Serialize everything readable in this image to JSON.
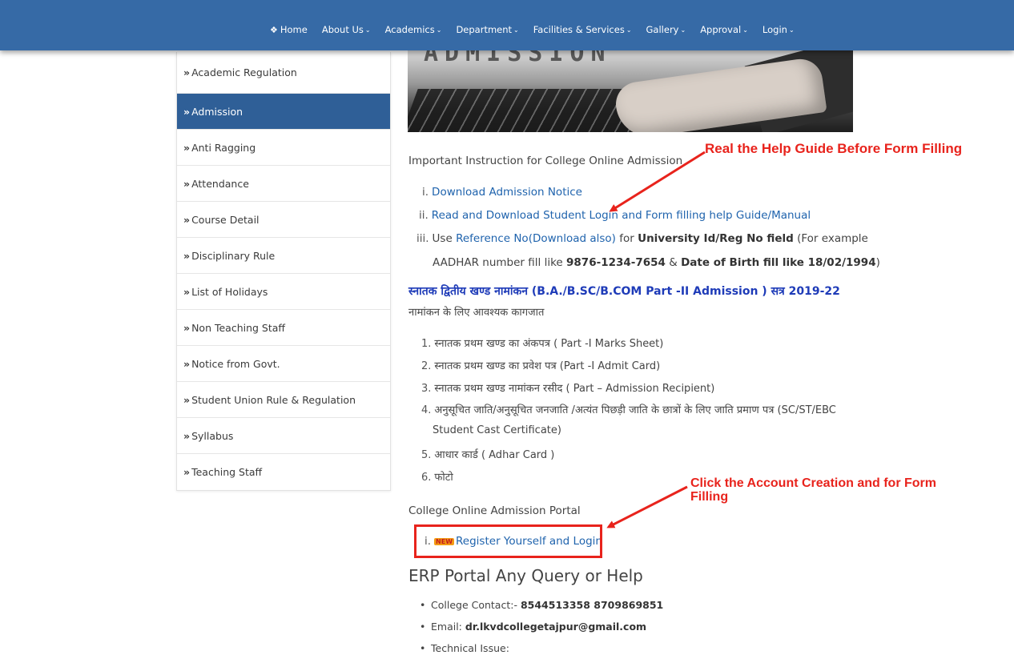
{
  "nav": {
    "items": [
      {
        "label": "Home",
        "icon": "home-icon",
        "chevron": false
      },
      {
        "label": "About Us",
        "chevron": true
      },
      {
        "label": "Academics",
        "chevron": true
      },
      {
        "label": "Department",
        "chevron": true
      },
      {
        "label": "Facilities & Services",
        "chevron": true
      },
      {
        "label": "Gallery",
        "chevron": true
      },
      {
        "label": "Approval",
        "chevron": true
      },
      {
        "label": "Login",
        "chevron": true
      }
    ]
  },
  "sidebar": {
    "items": [
      {
        "label": "Academic Regulation",
        "active": false
      },
      {
        "label": "Admission",
        "active": true
      },
      {
        "label": "Anti Ragging",
        "active": false
      },
      {
        "label": "Attendance",
        "active": false
      },
      {
        "label": "Course Detail",
        "active": false
      },
      {
        "label": "Disciplinary Rule",
        "active": false
      },
      {
        "label": "List of Holidays",
        "active": false
      },
      {
        "label": "Non Teaching Staff",
        "active": false
      },
      {
        "label": "Notice from Govt.",
        "active": false
      },
      {
        "label": "Student Union Rule & Regulation",
        "active": false
      },
      {
        "label": "Syllabus",
        "active": false
      },
      {
        "label": "Teaching Staff",
        "active": false
      }
    ]
  },
  "content": {
    "intro": "Important Instruction for College Online Admission",
    "instructions": [
      {
        "num": "i.",
        "link": "Download Admission Notice"
      },
      {
        "num": "ii.",
        "link": "Read and Download Student Login and Form filling help Guide/Manual"
      }
    ],
    "instruction3": {
      "num": "iii.",
      "prefix": "Use ",
      "link": "Reference No(Download also)",
      "mid": " for ",
      "bold1": "University Id/Reg No field",
      "tail": " (For example",
      "line2_prefix": "AADHAR number fill like ",
      "bold2": "9876-1234-7654",
      "amp": " & ",
      "bold3": "Date of Birth fill like 18/02/1994",
      "close": ")"
    },
    "hindi_heading": "स्नातक द्वितीय खण्ड नामांकन (B.A./B.SC/B.COM Part -II Admission ) सत्र 2019-22",
    "hindi_sub": "नामांकन के लिए आवश्यक कागजात",
    "documents": [
      {
        "num": "1.",
        "text": "स्नातक प्रथम खण्ड का अंकपत्र ( Part -I Marks Sheet)"
      },
      {
        "num": "2.",
        "text": "स्नातक प्रथम खण्ड का प्रवेश पत्र (Part -I Admit Card)"
      },
      {
        "num": "3.",
        "text": "स्नातक प्रथम खण्ड नामांकन रसीद ( Part – Admission Recipient)"
      },
      {
        "num": "4.",
        "text": "अनुसूचित जाति/अनुसूचित जनजाति /अत्यंत पिछड़ी जाति के छात्रों के लिए जाति प्रमाण पत्र (SC/ST/EBC",
        "text2": "Student Cast Certificate)"
      },
      {
        "num": "5.",
        "text": "आधार कार्ड ( Adhar Card )"
      },
      {
        "num": "6.",
        "text": "फोटो"
      }
    ],
    "portal_heading": "College Online Admission Portal",
    "portal_item": {
      "num": "i.",
      "badge": "NEW",
      "link": "Register Yourself and Login"
    },
    "erp_heading": "ERP Portal Any Query or Help",
    "contacts": [
      {
        "label": "College Contact:- ",
        "value": "8544513358  8709869851"
      },
      {
        "label": "Email: ",
        "value": "dr.lkvdcollegetajpur@gmail.com"
      },
      {
        "label": "Technical Issue:",
        "value": ""
      }
    ]
  },
  "hero": {
    "caption_text": "ADMISSION"
  },
  "annotations": {
    "top": "Real the Help Guide Before Form Filling",
    "bottom_line1": "Click the Account Creation and for Form",
    "bottom_line2": "Filling",
    "color": "#e8231c"
  },
  "colors": {
    "nav": "#366aa6",
    "active": "#2f5f97",
    "link": "#1f63ad",
    "hindi_heading": "#1e3bb8"
  }
}
